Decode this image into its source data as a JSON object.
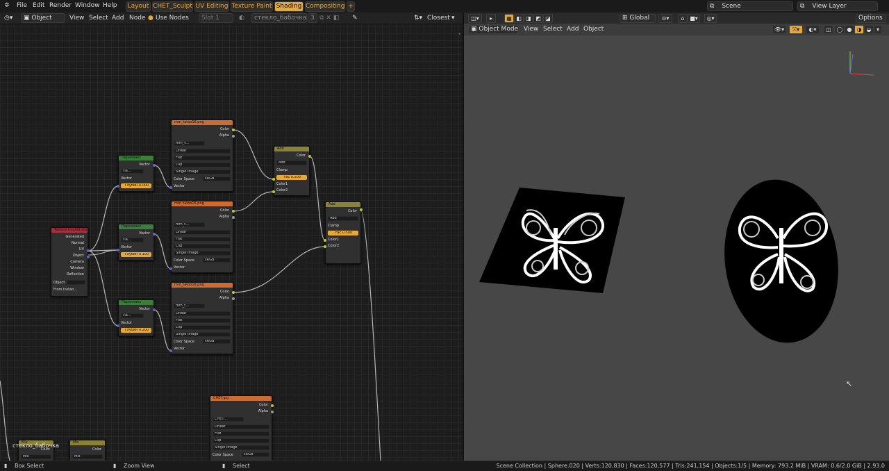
{
  "topbar": {
    "menus": [
      "File",
      "Edit",
      "Render",
      "Window",
      "Help"
    ],
    "workspaces": [
      "Layout",
      "CHET_Sculpt",
      "UV Editing",
      "Texture Paint",
      "Shading",
      "Compositing"
    ],
    "active_workspace": "Shading",
    "add_tab": "+",
    "scene": "Scene",
    "view_layer": "View Layer"
  },
  "node_header": {
    "object_mode": "Object",
    "menus": [
      "View",
      "Select",
      "Add",
      "Node"
    ],
    "use_nodes": "Use Nodes",
    "slot": "Slot 1",
    "material": "стекло_бабочка",
    "users": "3",
    "interp": "Closest"
  },
  "nodes": {
    "tex1": {
      "title": "mm_tatoo16.png",
      "name": "mm_t...",
      "outputs": [
        "Color",
        "Alpha"
      ],
      "options": [
        "Linear",
        "Flat",
        "Clip",
        "Single Image"
      ],
      "colorspace_label": "Color Space",
      "colorspace": "sRGB",
      "input": "Vector"
    },
    "tex2": {
      "title": "mm_tatoo16.png",
      "name": "mm_t...",
      "outputs": [
        "Color",
        "Alpha"
      ],
      "options": [
        "Linear",
        "Flat",
        "Clip",
        "Single Image"
      ],
      "colorspace_label": "Color Space",
      "colorspace": "sRGB",
      "input": "Vector"
    },
    "tex3": {
      "title": "mm_tatoo16.png",
      "name": "mm_t...",
      "outputs": [
        "Color",
        "Alpha"
      ],
      "options": [
        "Linear",
        "Flat",
        "Clip",
        "Single Image"
      ],
      "colorspace_label": "Color Space",
      "colorspace": "sRGB",
      "input": "Vector"
    },
    "tex4": {
      "title": "CHET.jpg",
      "name": "CHET...",
      "outputs": [
        "Color",
        "Alpha"
      ],
      "options": [
        "Linear",
        "Flat",
        "Clip",
        "Single Image"
      ],
      "colorspace_label": "Color Space",
      "colorspace": "sRGB"
    },
    "par1": {
      "title": "Параллакс",
      "out": "Vector",
      "name": "Па...",
      "input": "Vector",
      "depth": "Глубин 0.000"
    },
    "par2": {
      "title": "Параллакс",
      "out": "Vector",
      "name": "Па...",
      "input": "Vector",
      "depth": "Глубин 0.100"
    },
    "par3": {
      "title": "Параллакс",
      "out": "Vector",
      "name": "Па...",
      "input": "Vector",
      "depth": "Глубин 0.200"
    },
    "texcoord": {
      "title": "Texture Coordinate",
      "outputs": [
        "Generated",
        "Normal",
        "UV",
        "Object",
        "Camera",
        "Window",
        "Reflection"
      ],
      "object_label": "Object",
      "from_instancer": "From Instan..."
    },
    "add1": {
      "title": "Add",
      "out": "Color",
      "mode": "Add",
      "clamp": "Clamp",
      "fac": "Fac",
      "fac_val": "0.500",
      "in1": "Color1",
      "in2": "Color2"
    },
    "add2": {
      "title": "Add",
      "out": "Color",
      "mode": "Add",
      "clamp": "Clamp",
      "fac": "Fac",
      "fac_val": "0.500",
      "in1": "Color1",
      "in2": "Color2"
    },
    "mix1": {
      "title": "Mix",
      "out": "Color",
      "mode": "Mix"
    },
    "mix2": {
      "title": "Mix",
      "out": "Color",
      "mode": "Mix"
    },
    "frame_label": "стекло_бабочка"
  },
  "viewport": {
    "object_mode": "Object Mode",
    "menus": [
      "View",
      "Select",
      "Add",
      "Object"
    ],
    "transform": "Global",
    "options": "Options"
  },
  "status": {
    "box_select": "Box Select",
    "zoom_view": "Zoom View",
    "select": "Select",
    "stats": "Scene Collection | Sphere.020 | Verts:120,830 | Faces:120,577 | Tris:241,154 | Objects:1/5 | Memory: 793.2 MiB | VRAM: 0.6/2.0 GiB | 2.93.0"
  },
  "colors": {
    "accent": "#e5a83a",
    "texture_header": "#c96c36",
    "mix_header": "#8a8237",
    "vector_header": "#3c7f3c",
    "input_header": "#a3303c"
  }
}
